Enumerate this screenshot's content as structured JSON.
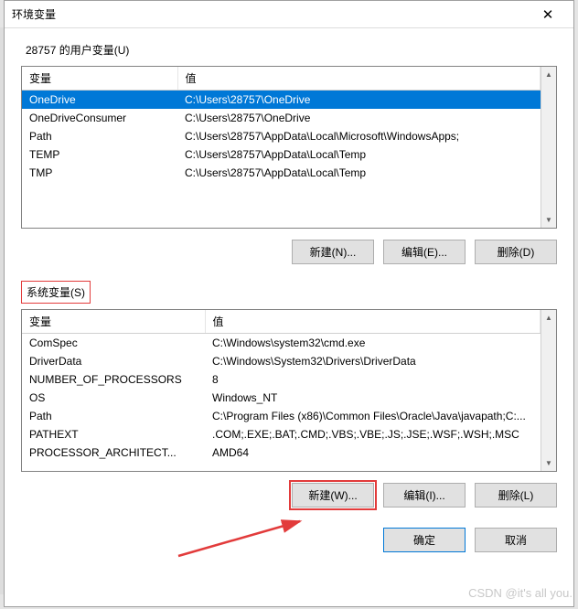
{
  "titlebar": {
    "title": "环境变量",
    "close": "✕"
  },
  "user_section": {
    "label": "28757 的用户变量(U)",
    "headers": {
      "variable": "变量",
      "value": "值"
    },
    "rows": [
      {
        "variable": "OneDrive",
        "value": "C:\\Users\\28757\\OneDrive",
        "selected": true
      },
      {
        "variable": "OneDriveConsumer",
        "value": "C:\\Users\\28757\\OneDrive",
        "selected": false
      },
      {
        "variable": "Path",
        "value": "C:\\Users\\28757\\AppData\\Local\\Microsoft\\WindowsApps;",
        "selected": false
      },
      {
        "variable": "TEMP",
        "value": "C:\\Users\\28757\\AppData\\Local\\Temp",
        "selected": false
      },
      {
        "variable": "TMP",
        "value": "C:\\Users\\28757\\AppData\\Local\\Temp",
        "selected": false
      }
    ],
    "buttons": {
      "new": "新建(N)...",
      "edit": "编辑(E)...",
      "delete": "删除(D)"
    }
  },
  "system_section": {
    "label": "系统变量(S)",
    "headers": {
      "variable": "变量",
      "value": "值"
    },
    "rows": [
      {
        "variable": "ComSpec",
        "value": "C:\\Windows\\system32\\cmd.exe"
      },
      {
        "variable": "DriverData",
        "value": "C:\\Windows\\System32\\Drivers\\DriverData"
      },
      {
        "variable": "NUMBER_OF_PROCESSORS",
        "value": "8"
      },
      {
        "variable": "OS",
        "value": "Windows_NT"
      },
      {
        "variable": "Path",
        "value": "C:\\Program Files (x86)\\Common Files\\Oracle\\Java\\javapath;C:..."
      },
      {
        "variable": "PATHEXT",
        "value": ".COM;.EXE;.BAT;.CMD;.VBS;.VBE;.JS;.JSE;.WSF;.WSH;.MSC"
      },
      {
        "variable": "PROCESSOR_ARCHITECT...",
        "value": "AMD64"
      }
    ],
    "buttons": {
      "new": "新建(W)...",
      "edit": "编辑(I)...",
      "delete": "删除(L)"
    }
  },
  "dialog_buttons": {
    "ok": "确定",
    "cancel": "取消"
  },
  "watermark": "CSDN @it's all you.",
  "scrollbar": {
    "up": "▲",
    "down": "▼"
  }
}
